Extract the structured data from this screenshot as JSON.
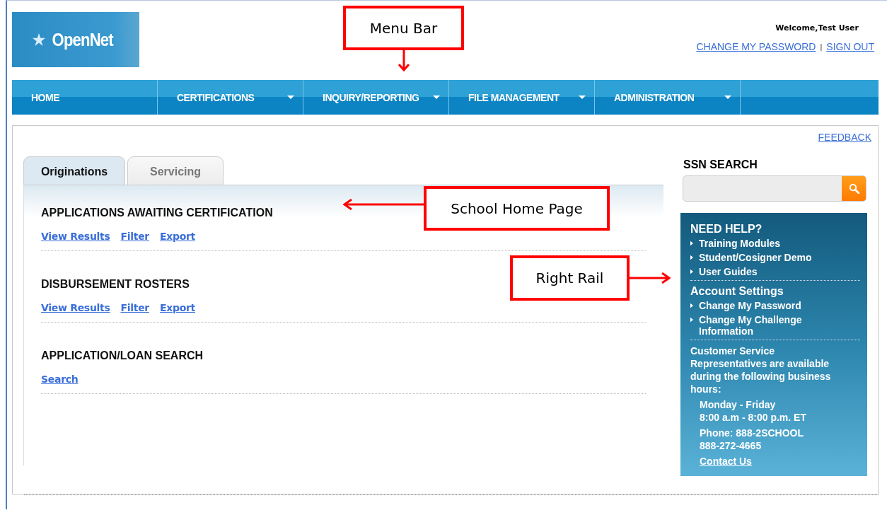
{
  "header": {
    "logo": "OpenNet",
    "welcome": "Welcome,Test User",
    "links": [
      "CHANGE MY PASSWORD",
      "SIGN OUT"
    ],
    "separator": "|"
  },
  "menu": [
    {
      "label": "HOME",
      "kind": "link"
    },
    {
      "label": "CERTIFICATIONS",
      "kind": "dropdown"
    },
    {
      "label": "INQUIRY/REPORTING",
      "kind": "dropdown"
    },
    {
      "label": "FILE MANAGEMENT",
      "kind": "dropdown"
    },
    {
      "label": "ADMINISTRATION",
      "kind": "dropdown"
    }
  ],
  "feedback": "FEEDBACK",
  "tabs": [
    {
      "label": "Originations",
      "selected": true
    },
    {
      "label": "Servicing",
      "selected": false
    }
  ],
  "sections": [
    {
      "title": "APPLICATIONS AWAITING CERTIFICATION",
      "links": [
        "View Results",
        "Filter",
        "Export"
      ]
    },
    {
      "title": "DISBURSEMENT ROSTERS",
      "links": [
        "View Results",
        "Filter",
        "Export"
      ]
    },
    {
      "title": "APPLICATION/LOAN SEARCH",
      "links": [
        "Search"
      ]
    }
  ],
  "ssn_search": {
    "title": "SSN SEARCH"
  },
  "right_rail": {
    "help_title": "NEED HELP?",
    "help_links": [
      "Training Modules",
      "Student/Cosigner Demo",
      "User Guides"
    ],
    "account_title": "Account Settings",
    "account_links": [
      "Change My Password",
      "Change My Challenge Information"
    ],
    "service_text": "Customer Service Representatives are available during the following business hours:",
    "hours": [
      "Monday - Friday",
      "8:00 a.m - 8:00 p.m. ET"
    ],
    "phone": [
      "Phone: 888-2SCHOOL",
      "888-272-4665"
    ],
    "contact": "Contact Us"
  },
  "callouts": [
    {
      "label": "Menu Bar",
      "kind": "down"
    },
    {
      "label": "School Home Page",
      "kind": "left"
    },
    {
      "label": "Right Rail",
      "kind": "right"
    }
  ]
}
